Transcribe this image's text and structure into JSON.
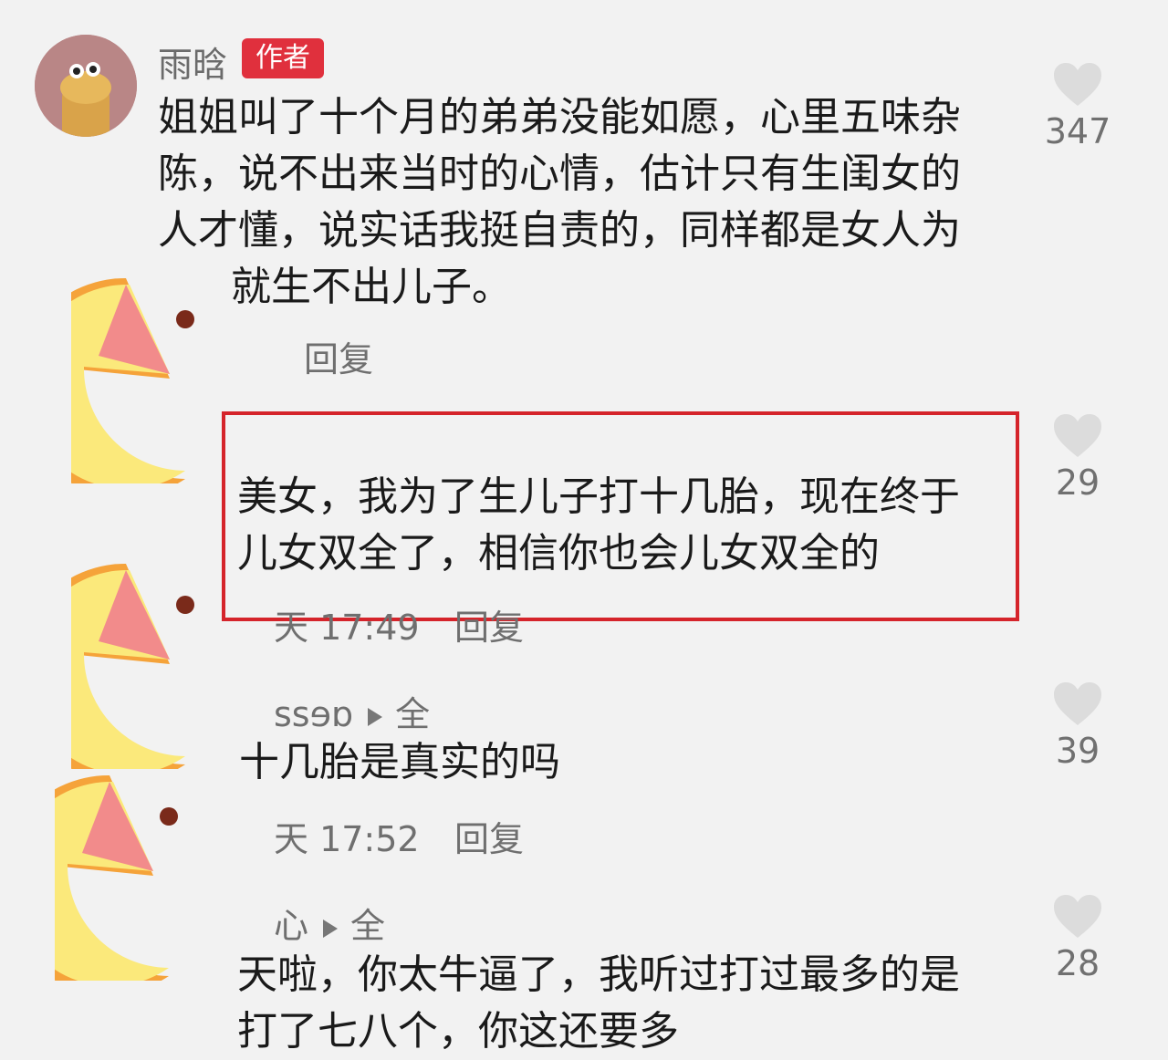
{
  "comment1": {
    "author": "雨晗",
    "badge": "作者",
    "lines": [
      "姐姐叫了十个月的弟弟没能如愿，心里五味杂",
      "陈，说不出来当时的心情，估计只有生闺女的",
      "人才懂，说实话我挺自责的，同样都是女人为",
      "就生不出儿子。"
    ],
    "reply_label": "回复",
    "likes": "347"
  },
  "comment2": {
    "lines": [
      "美女，我为了生儿子打十几胎，现在终于",
      "儿女双全了，相信你也会儿女双全的"
    ],
    "time": "天 17:49",
    "reply_label": "回复",
    "likes": "29"
  },
  "comment3": {
    "author_fragment": "ssɘɒ",
    "reply_to": "全",
    "text": "十几胎是真实的吗",
    "time": "天 17:52",
    "reply_label": "回复",
    "likes": "39"
  },
  "comment4": {
    "author_fragment": "心",
    "reply_to": "全",
    "lines": [
      "天啦，你太牛逼了，我听过打过最多的是",
      "打了七八个，你这还要多"
    ],
    "likes": "28"
  },
  "icons": {
    "like": "heart-icon",
    "reply_arrow": "play-icon"
  },
  "colors": {
    "badge": "#e0303d",
    "highlight_border": "#d5242b",
    "mask_fill": "#fbe97b",
    "mask_edge": "#f5a33a"
  }
}
